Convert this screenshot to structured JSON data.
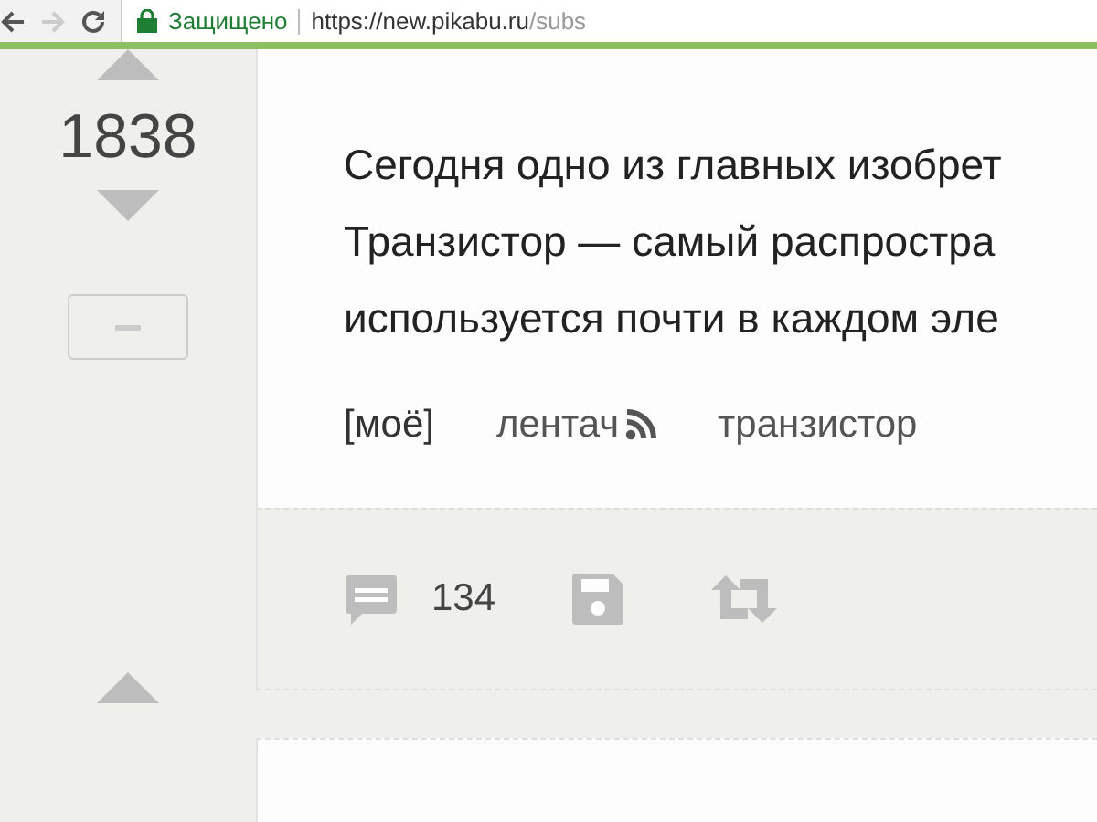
{
  "browser": {
    "security_label": "Защищено",
    "url_host": "https://new.pikabu.ru",
    "url_path": "/subs"
  },
  "post": {
    "rating": "1838",
    "text_lines": [
      "Сегодня одно из главных изобрет",
      "Транзистор — самый распростра",
      "используется почти в каждом эле"
    ],
    "tags": [
      {
        "label": "[моё]",
        "kind": "mine"
      },
      {
        "label": "лентач",
        "kind": "community"
      },
      {
        "label": "транзистор",
        "kind": "tag"
      }
    ],
    "comments_count": "134"
  }
}
